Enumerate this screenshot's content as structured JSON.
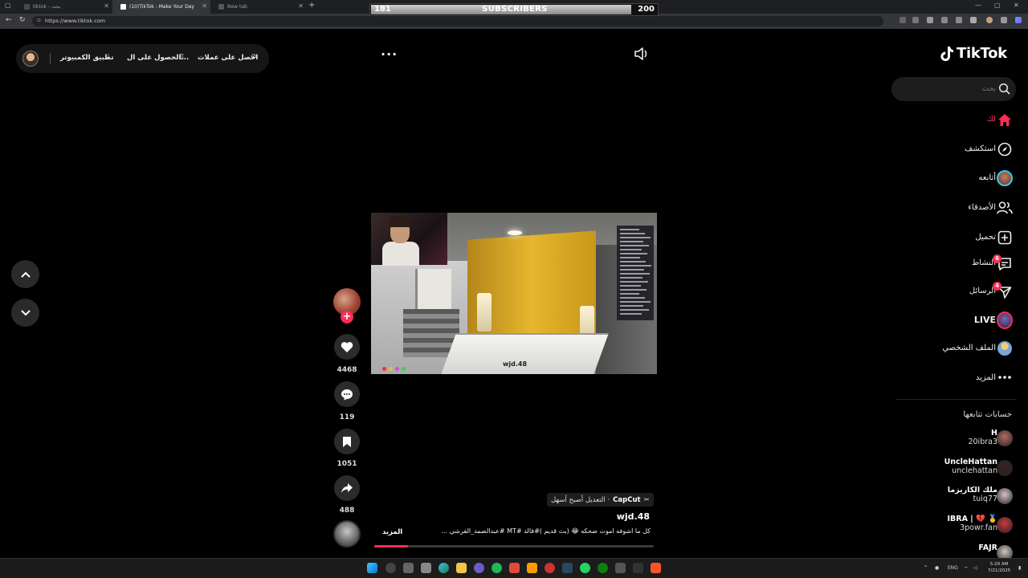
{
  "browser": {
    "tabs": [
      {
        "label": "tiktok - بحث",
        "active": false
      },
      {
        "label": "(10)TikTok - Make Your Day",
        "active": true
      },
      {
        "label": "New tab",
        "active": false
      }
    ],
    "url": "https://www.tiktok.com"
  },
  "subscriber_widget": {
    "current": "181",
    "label": "SUBSCRIBERS",
    "goal": "200",
    "progress": 0.905
  },
  "top_bar": {
    "get_coins": "احصل على عملات",
    "get_app": "الحصول على ال...",
    "desktop_app": "تطبيق الكمبيوتر"
  },
  "video": {
    "overlay_tag": "wjd.48",
    "likes": "4468",
    "comments": "119",
    "saves": "1051",
    "shares": "488",
    "capcut_brand": "CapCut",
    "capcut_text": "· التعديل أصبح أسهل",
    "author": "wjd.48",
    "caption": "كل ما اشوفه اموت ضحكه 😂 (بث قديم )#قالد #MT #عبدالصمد_القرشي ...",
    "more_label": "المزيد",
    "progress": 0.12
  },
  "sidebar": {
    "logo": "TikTok",
    "search_placeholder": "بحث",
    "items": [
      {
        "label": "لك",
        "icon": "home-icon",
        "active": true
      },
      {
        "label": "استكشف",
        "icon": "compass-icon"
      },
      {
        "label": "أتابعه",
        "icon": "following-avatar-icon"
      },
      {
        "label": "الأصدقاء",
        "icon": "friends-icon"
      },
      {
        "label": "تحميل",
        "icon": "upload-icon"
      },
      {
        "label": "النشاط",
        "icon": "activity-icon",
        "badge": "6"
      },
      {
        "label": "الرسائل",
        "icon": "messages-icon",
        "badge": "4"
      },
      {
        "label": "LIVE",
        "icon": "live-icon"
      },
      {
        "label": "الملف الشخصي",
        "icon": "profile-icon"
      },
      {
        "label": "المزيد",
        "icon": "more-icon"
      }
    ],
    "following_title": "حسابات تتابعها",
    "following": [
      {
        "name": "H",
        "user": "20ibra3",
        "color": "#b56a62"
      },
      {
        "name": "UncleHattan",
        "user": "unclehattan",
        "color": "#3a2222"
      },
      {
        "name": "ملك الكاريزما",
        "user": "tuiq77",
        "color": "#d7c1c9"
      },
      {
        "name": "IBRA | 💔 🥇",
        "user": "3powr.fan",
        "color": "#c93a3a"
      },
      {
        "name": "FAJR",
        "user": "",
        "color": "#cfc6c0"
      }
    ]
  },
  "taskbar": {
    "lang": "ENG",
    "time": "5:29 AM",
    "date": "7/21/2025"
  },
  "colors": {
    "accent": "#fe2c55",
    "background": "#000000"
  }
}
